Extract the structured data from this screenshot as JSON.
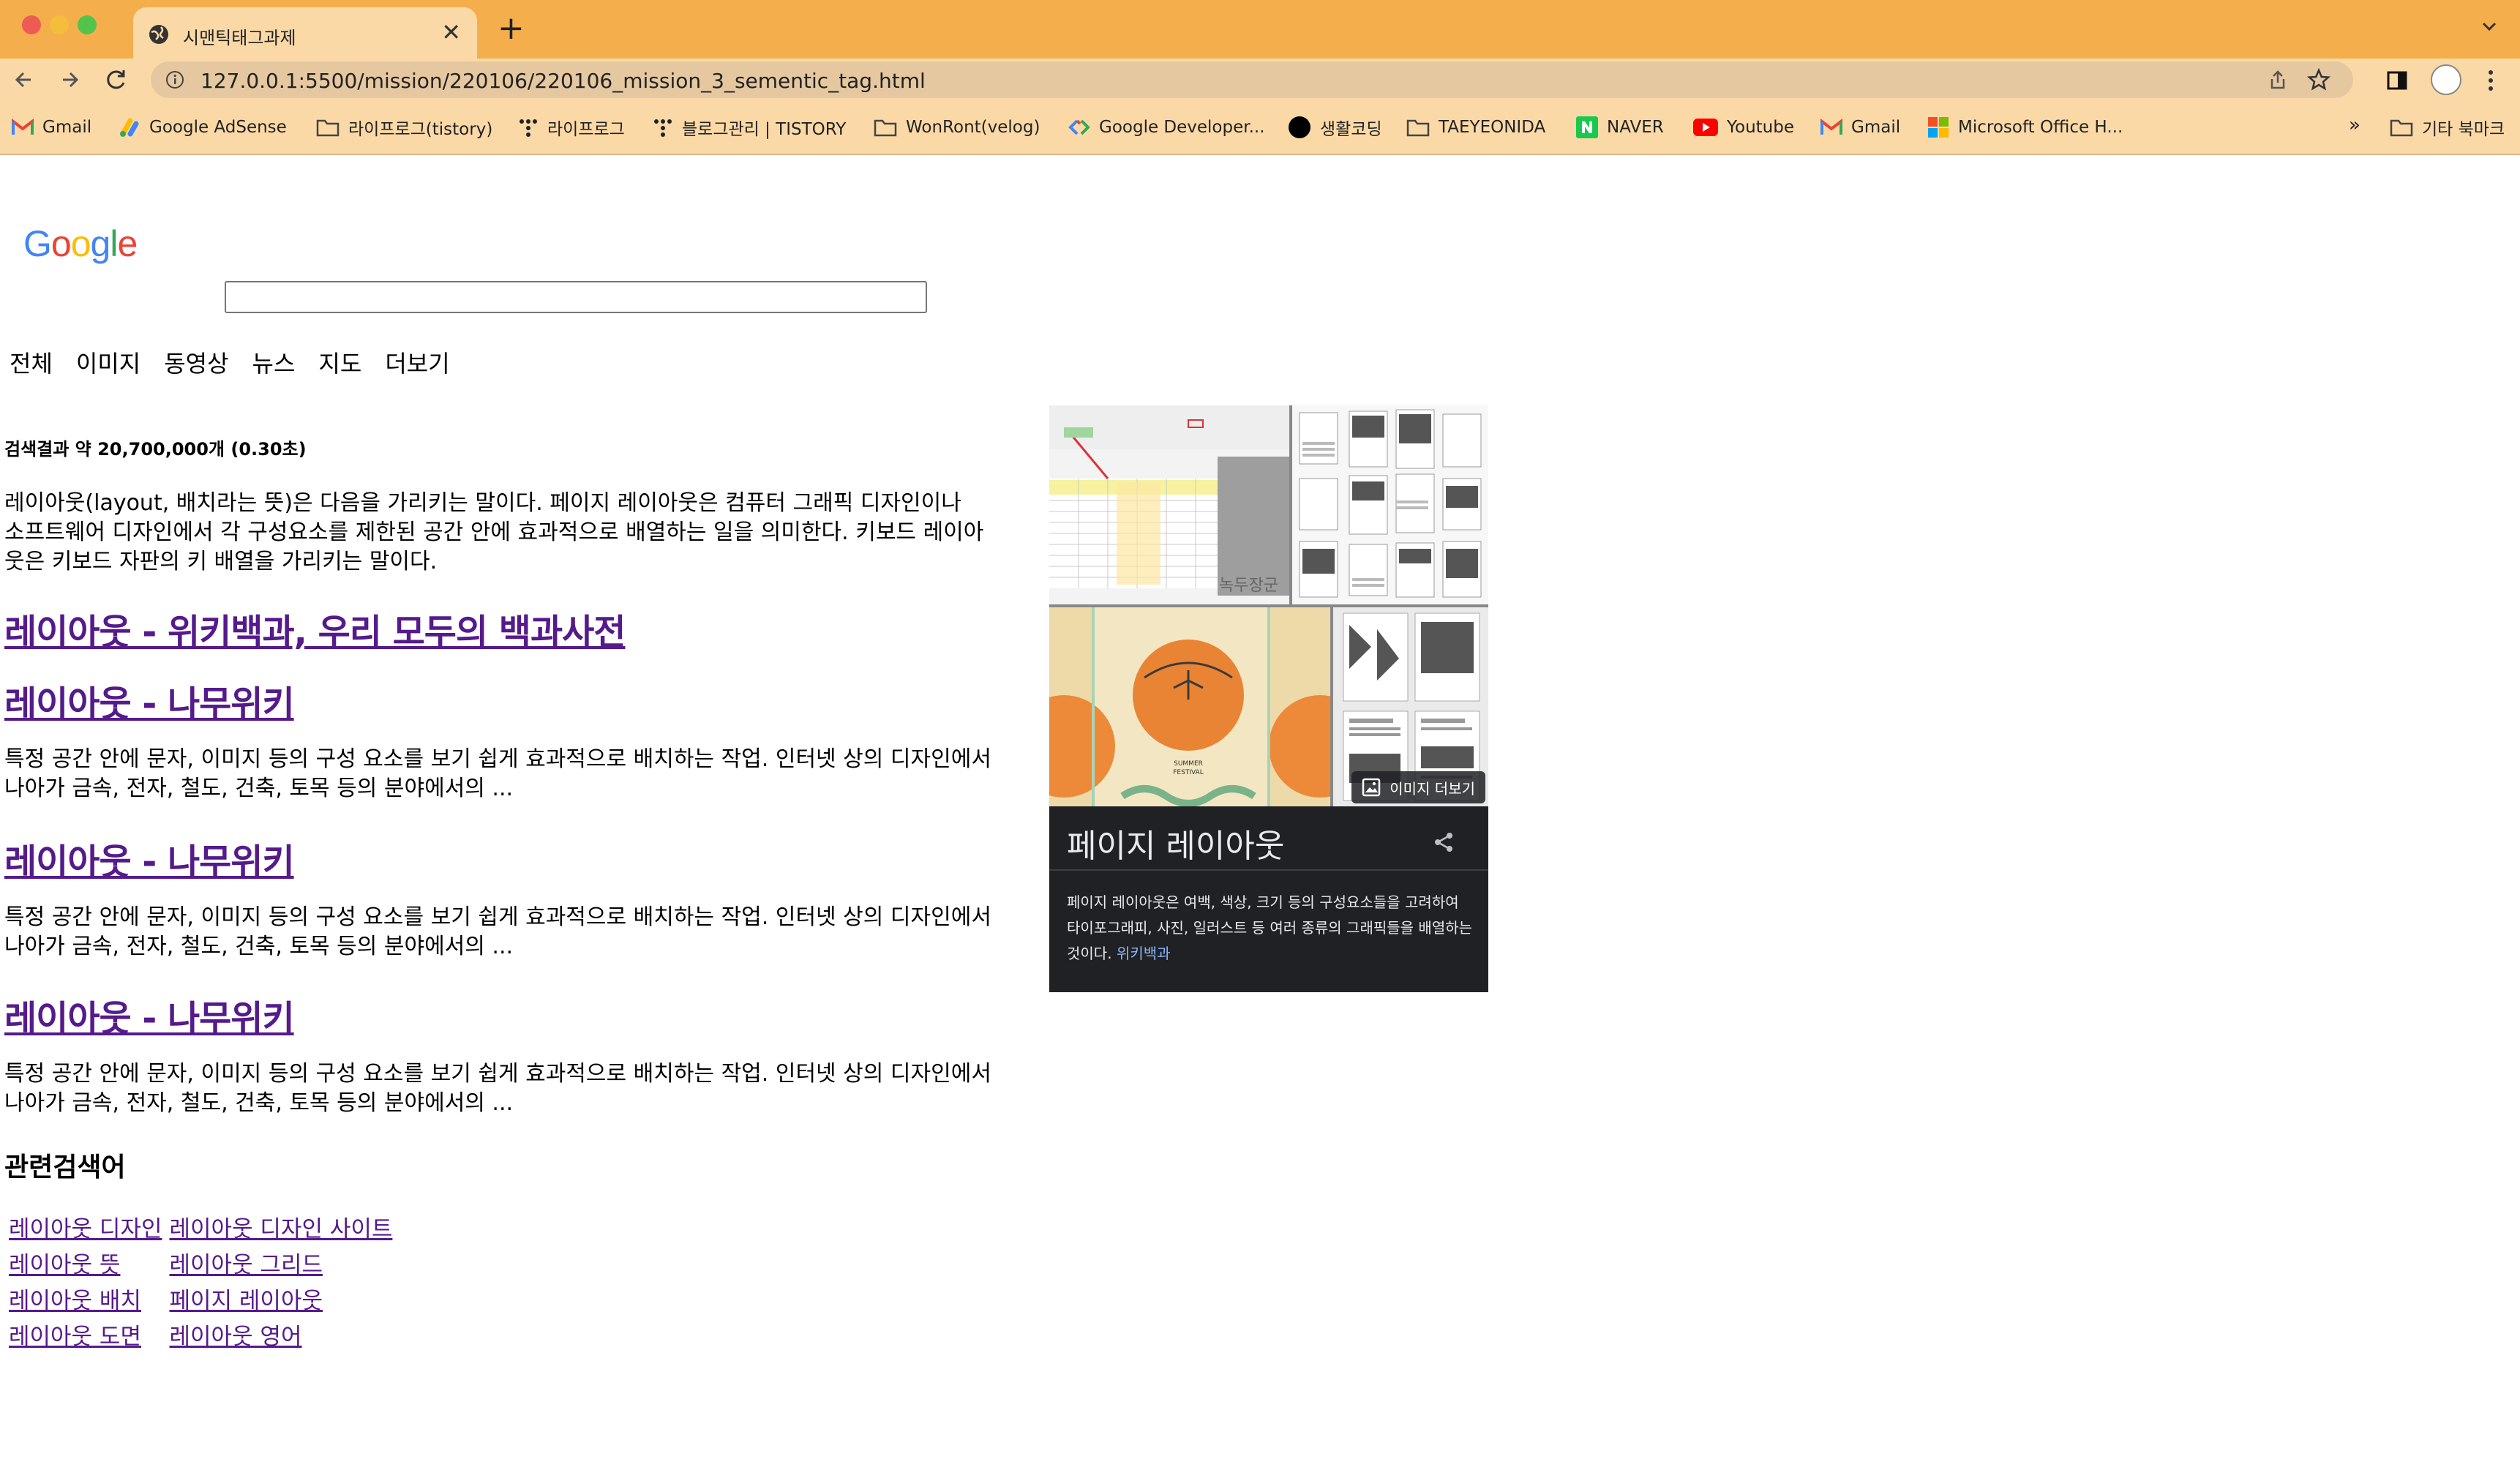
{
  "browser": {
    "tab_title": "시맨틱태그과제",
    "tab_close": "✕",
    "new_tab": "+",
    "url": "127.0.0.1:5500/mission/220106/220106_mission_3_sementic_tag.html",
    "bookmarks": [
      {
        "label": "Gmail",
        "icon": "gmail-icon"
      },
      {
        "label": "Google AdSense",
        "icon": "adsense-icon"
      },
      {
        "label": "라이프로그(tistory)",
        "icon": "folder-icon"
      },
      {
        "label": "라이프로그",
        "icon": "tistory-icon"
      },
      {
        "label": "블로그관리 | TISTORY",
        "icon": "tistory-icon"
      },
      {
        "label": "WonRont(velog)",
        "icon": "folder-icon"
      },
      {
        "label": "Google Developer...",
        "icon": "google-developers-icon"
      },
      {
        "label": "생활코딩",
        "icon": "opentutorials-icon"
      },
      {
        "label": "TAEYEONIDA",
        "icon": "folder-icon"
      },
      {
        "label": "NAVER",
        "icon": "naver-icon"
      },
      {
        "label": "Youtube",
        "icon": "youtube-icon"
      },
      {
        "label": "Gmail",
        "icon": "gmail-icon"
      },
      {
        "label": "Microsoft Office H...",
        "icon": "microsoft-icon"
      }
    ],
    "bookmarks_more": "»",
    "other_bookmarks": "기타 북마크"
  },
  "page": {
    "logo": [
      "G",
      "o",
      "o",
      "g",
      "l",
      "e"
    ],
    "logo_colors": [
      "#4285f4",
      "#ea4335",
      "#fbbc05",
      "#4285f4",
      "#34a853",
      "#ea4335"
    ],
    "search_value": "",
    "menu": [
      "전체",
      "이미지",
      "동영상",
      "뉴스",
      "지도",
      "더보기"
    ],
    "result_stats": "검색결과 약 20,700,000개 (0.30초)",
    "intro": "레이아웃(layout, 배치라는 뜻)은 다음을 가리키는 말이다. 페이지 레이아웃은 컴퓨터 그래픽 디자인이나 소프트웨어 디자인에서 각 구성요소를 제한된 공간 안에 효과적으로 배열하는 일을 의미한다. 키보드 레이아웃은 키보드 자판의 키 배열을 가리키는 말이다.",
    "results": [
      {
        "title": "레이아웃 - 위키백과, 우리 모두의 백과사전",
        "desc": ""
      },
      {
        "title": "레이아웃 - 나무위키",
        "desc": "특정 공간 안에 문자, 이미지 등의 구성 요소를 보기 쉽게 효과적으로 배치하는 작업. 인터넷 상의 디자인에서 나아가 금속, 전자, 철도, 건축, 토목 등의 분야에서의 ..."
      },
      {
        "title": "레이아웃 - 나무위키",
        "desc": "특정 공간 안에 문자, 이미지 등의 구성 요소를 보기 쉽게 효과적으로 배치하는 작업. 인터넷 상의 디자인에서 나아가 금속, 전자, 철도, 건축, 토목 등의 분야에서의 ..."
      },
      {
        "title": "레이아웃 - 나무위키",
        "desc": "특정 공간 안에 문자, 이미지 등의 구성 요소를 보기 쉽게 효과적으로 배치하는 작업. 인터넷 상의 디자인에서 나아가 금속, 전자, 철도, 건축, 토목 등의 분야에서의 ..."
      }
    ],
    "related_title": "관련검색어",
    "related": [
      [
        "레이아웃 디자인",
        "레이아웃 디자인 사이트"
      ],
      [
        "레이아웃 뜻",
        "레이아웃 그리드"
      ],
      [
        "레이아웃 배치",
        "페이지 레이아웃"
      ],
      [
        "레이아웃 도면",
        "레이아웃 영어"
      ]
    ]
  },
  "knowledge_panel": {
    "more_images": "이미지 더보기",
    "title": "페이지 레이아웃",
    "description": "페이지 레이아웃은 여백, 색상, 크기 등의 구성요소들을 고려하여 타이포그래피, 사진, 일러스트 등 여러 종류의 그래픽들을 배열하는 것이다.",
    "source": "위키백과",
    "poster_label": "SUMMER FESTIVAL",
    "spreadsheet_caption": "녹두장군"
  },
  "colors": {
    "tab_strip": "#f4ae4c",
    "toolbar": "#fbd9a7",
    "link_visited": "#551a8b",
    "panel_bg": "#202124",
    "panel_link": "#8ab4f8"
  }
}
